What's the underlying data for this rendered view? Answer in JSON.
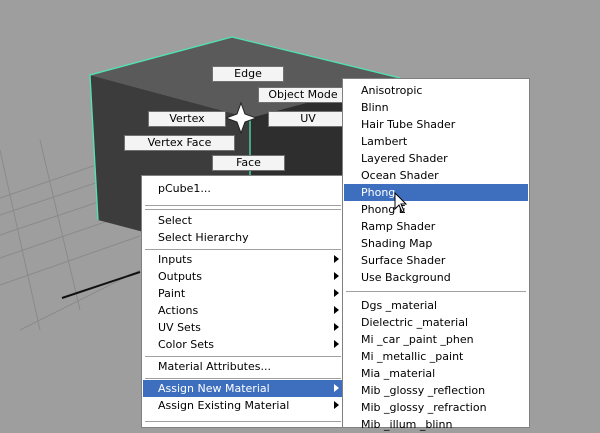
{
  "marking_menu": {
    "edge": "Edge",
    "object_mode": "Object Mode",
    "vertex": "Vertex",
    "uv": "UV",
    "vertex_face": "Vertex Face",
    "face": "Face"
  },
  "context_menu": {
    "object_name": "pCube1...",
    "select": "Select",
    "select_hierarchy": "Select Hierarchy",
    "inputs": "Inputs",
    "outputs": "Outputs",
    "paint": "Paint",
    "actions": "Actions",
    "uv_sets": "UV Sets",
    "color_sets": "Color Sets",
    "material_attributes": "Material Attributes...",
    "assign_new_material": "Assign New Material",
    "assign_existing_material": "Assign Existing Material"
  },
  "submenu": {
    "materials": [
      "Anisotropic",
      "Blinn",
      "Hair Tube Shader",
      "Lambert",
      "Layered Shader",
      "Ocean Shader",
      "Phong",
      "Phong E",
      "Ramp Shader",
      "Shading Map",
      "Surface Shader",
      "Use Background"
    ],
    "mental_ray": [
      "Dgs _material",
      "Dielectric _material",
      "Mi _car _paint _phen",
      "Mi _metallic _paint",
      "Mia _material",
      "Mib _glossy _reflection",
      "Mib _glossy _refraction",
      "Mib _illum _blinn"
    ],
    "highlighted": "Phong"
  },
  "colors": {
    "highlight": "#3e6fbe",
    "viewport": "#9e9e9e",
    "selection_wire": "#4ee6b0"
  }
}
